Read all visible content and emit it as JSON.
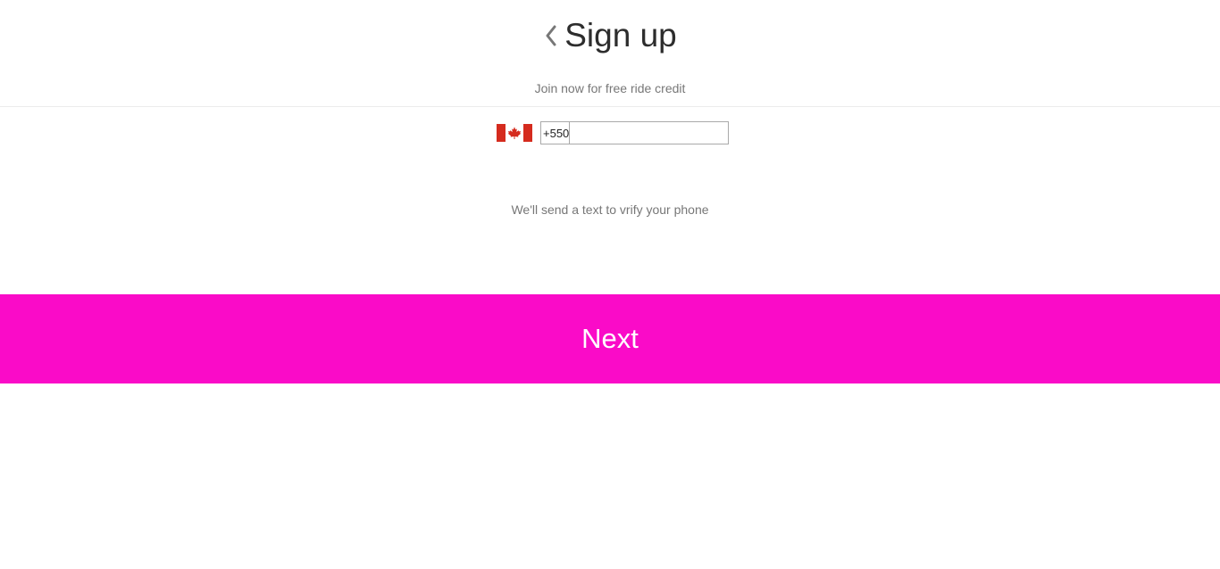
{
  "header": {
    "title": "Sign up",
    "subtitle": "Join now for free ride credit",
    "back_icon": "chevron-left-icon"
  },
  "phone": {
    "flag_icon": "canada-flag-icon",
    "country_code": "+550",
    "value": "",
    "placeholder": ""
  },
  "hint": "We'll send a text to vrify your phone",
  "next_button": {
    "label": "Next"
  },
  "colors": {
    "accent": "#fa0bc8",
    "flag_red": "#d52b1e",
    "text_dark": "#2d2d2d",
    "text_muted": "#777777"
  }
}
